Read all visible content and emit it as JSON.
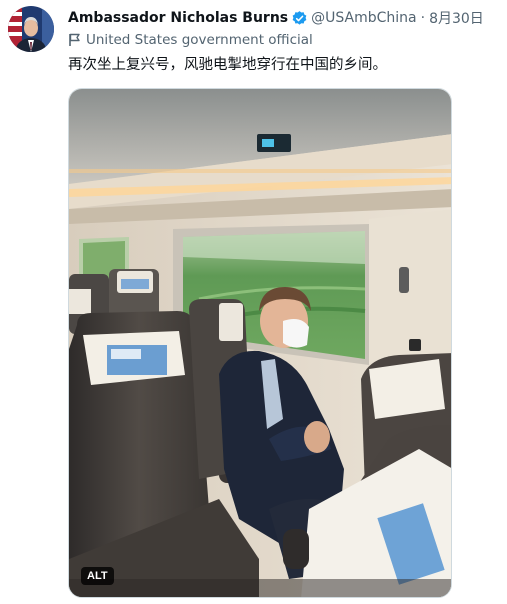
{
  "author": {
    "name": "Ambassador Nicholas Burns",
    "handle": "@USAmbChina",
    "separator": "·",
    "date": "8月30日",
    "verified_icon": "verified-badge-icon",
    "label": "United States government official",
    "label_icon": "flag-icon"
  },
  "tweet": {
    "text": "再次坐上复兴号，风驰电掣地穿行在中国的乡间。"
  },
  "media": {
    "alt_badge": "ALT"
  },
  "colors": {
    "verified_blue": "#1d9bf0",
    "muted_text": "#536471",
    "primary_text": "#0f1419"
  }
}
